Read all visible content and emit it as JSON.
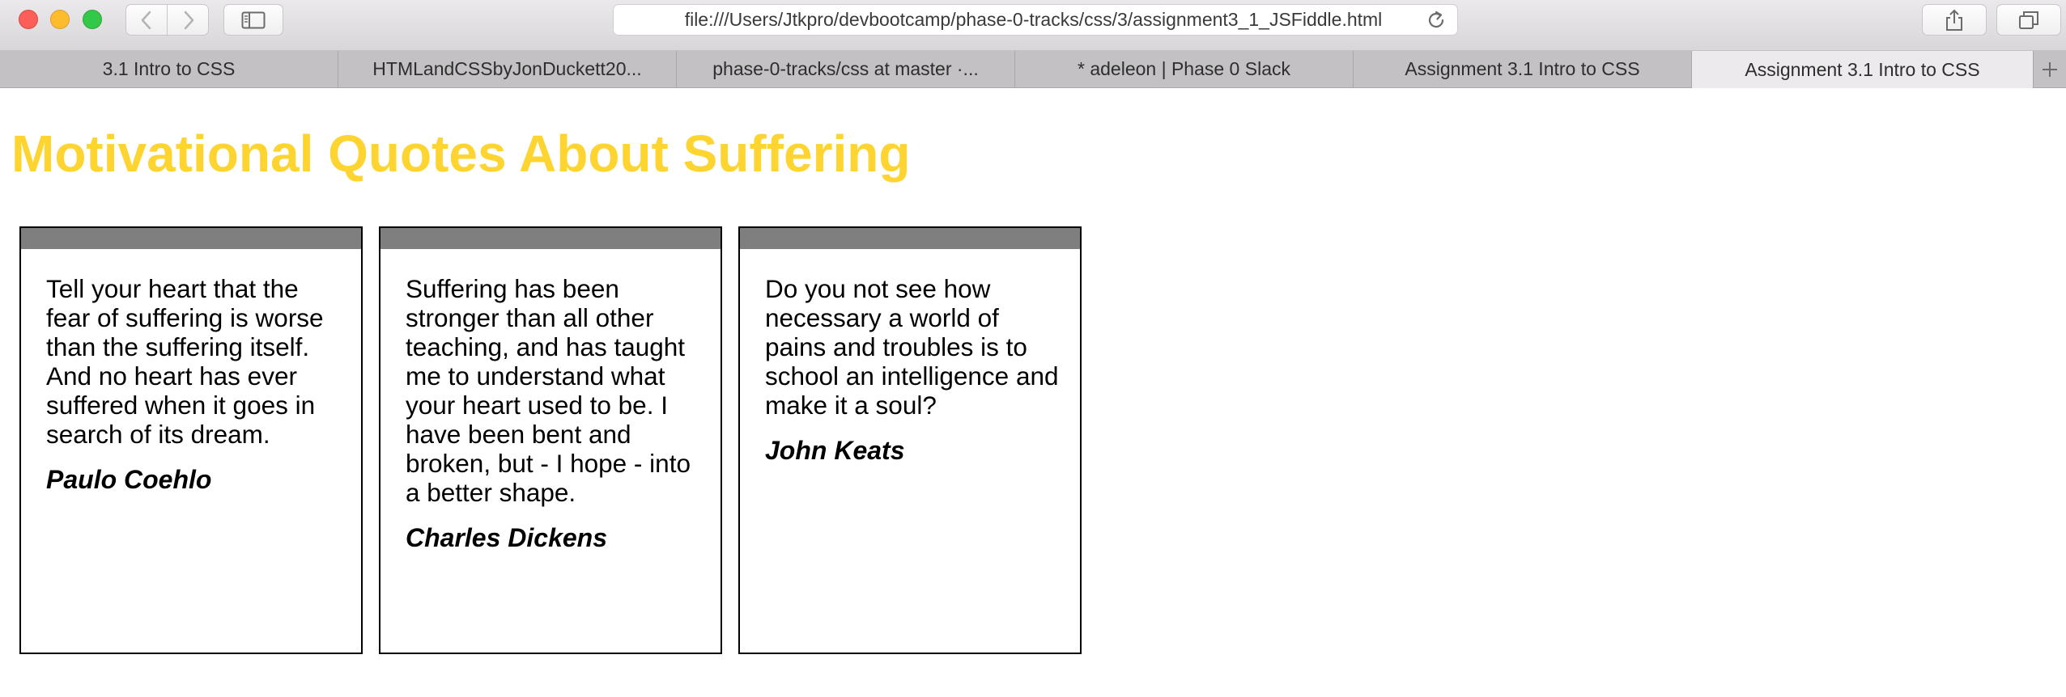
{
  "browser": {
    "url": "file:///Users/Jtkpro/devbootcamp/phase-0-tracks/css/3/assignment3_1_JSFiddle.html",
    "tabs": [
      {
        "label": "3.1 Intro to CSS",
        "active": false
      },
      {
        "label": "HTMLandCSSbyJonDuckett20...",
        "active": false
      },
      {
        "label": "phase-0-tracks/css at master ·...",
        "active": false
      },
      {
        "label": "* adeleon | Phase 0 Slack",
        "active": false
      },
      {
        "label": "Assignment 3.1 Intro to CSS",
        "active": false
      },
      {
        "label": "Assignment 3.1 Intro to CSS",
        "active": true
      }
    ],
    "icons": {
      "back": "chevron-left-icon",
      "forward": "chevron-right-icon",
      "sidebar": "sidebar-icon",
      "reload": "reload-icon",
      "share": "share-icon",
      "tabs_overview": "tabs-overview-icon",
      "new_tab": "plus-icon"
    }
  },
  "page": {
    "heading": "Motivational Quotes About Suffering",
    "heading_color": "#fed431",
    "cards": [
      {
        "quote": "Tell your heart that the fear of suffering is worse than the suffering itself. And no heart has ever suffered when it goes in search of its dream.",
        "author": "Paulo Coehlo"
      },
      {
        "quote": "Suffering has been stronger than all other teaching, and has taught me to understand what your heart used to be. I have been bent and broken, but - I hope - into a better shape.",
        "author": "Charles Dickens"
      },
      {
        "quote": "Do you not see how necessary a world of pains and troubles is to school an intelligence and make it a soul?",
        "author": "John Keats"
      }
    ]
  }
}
